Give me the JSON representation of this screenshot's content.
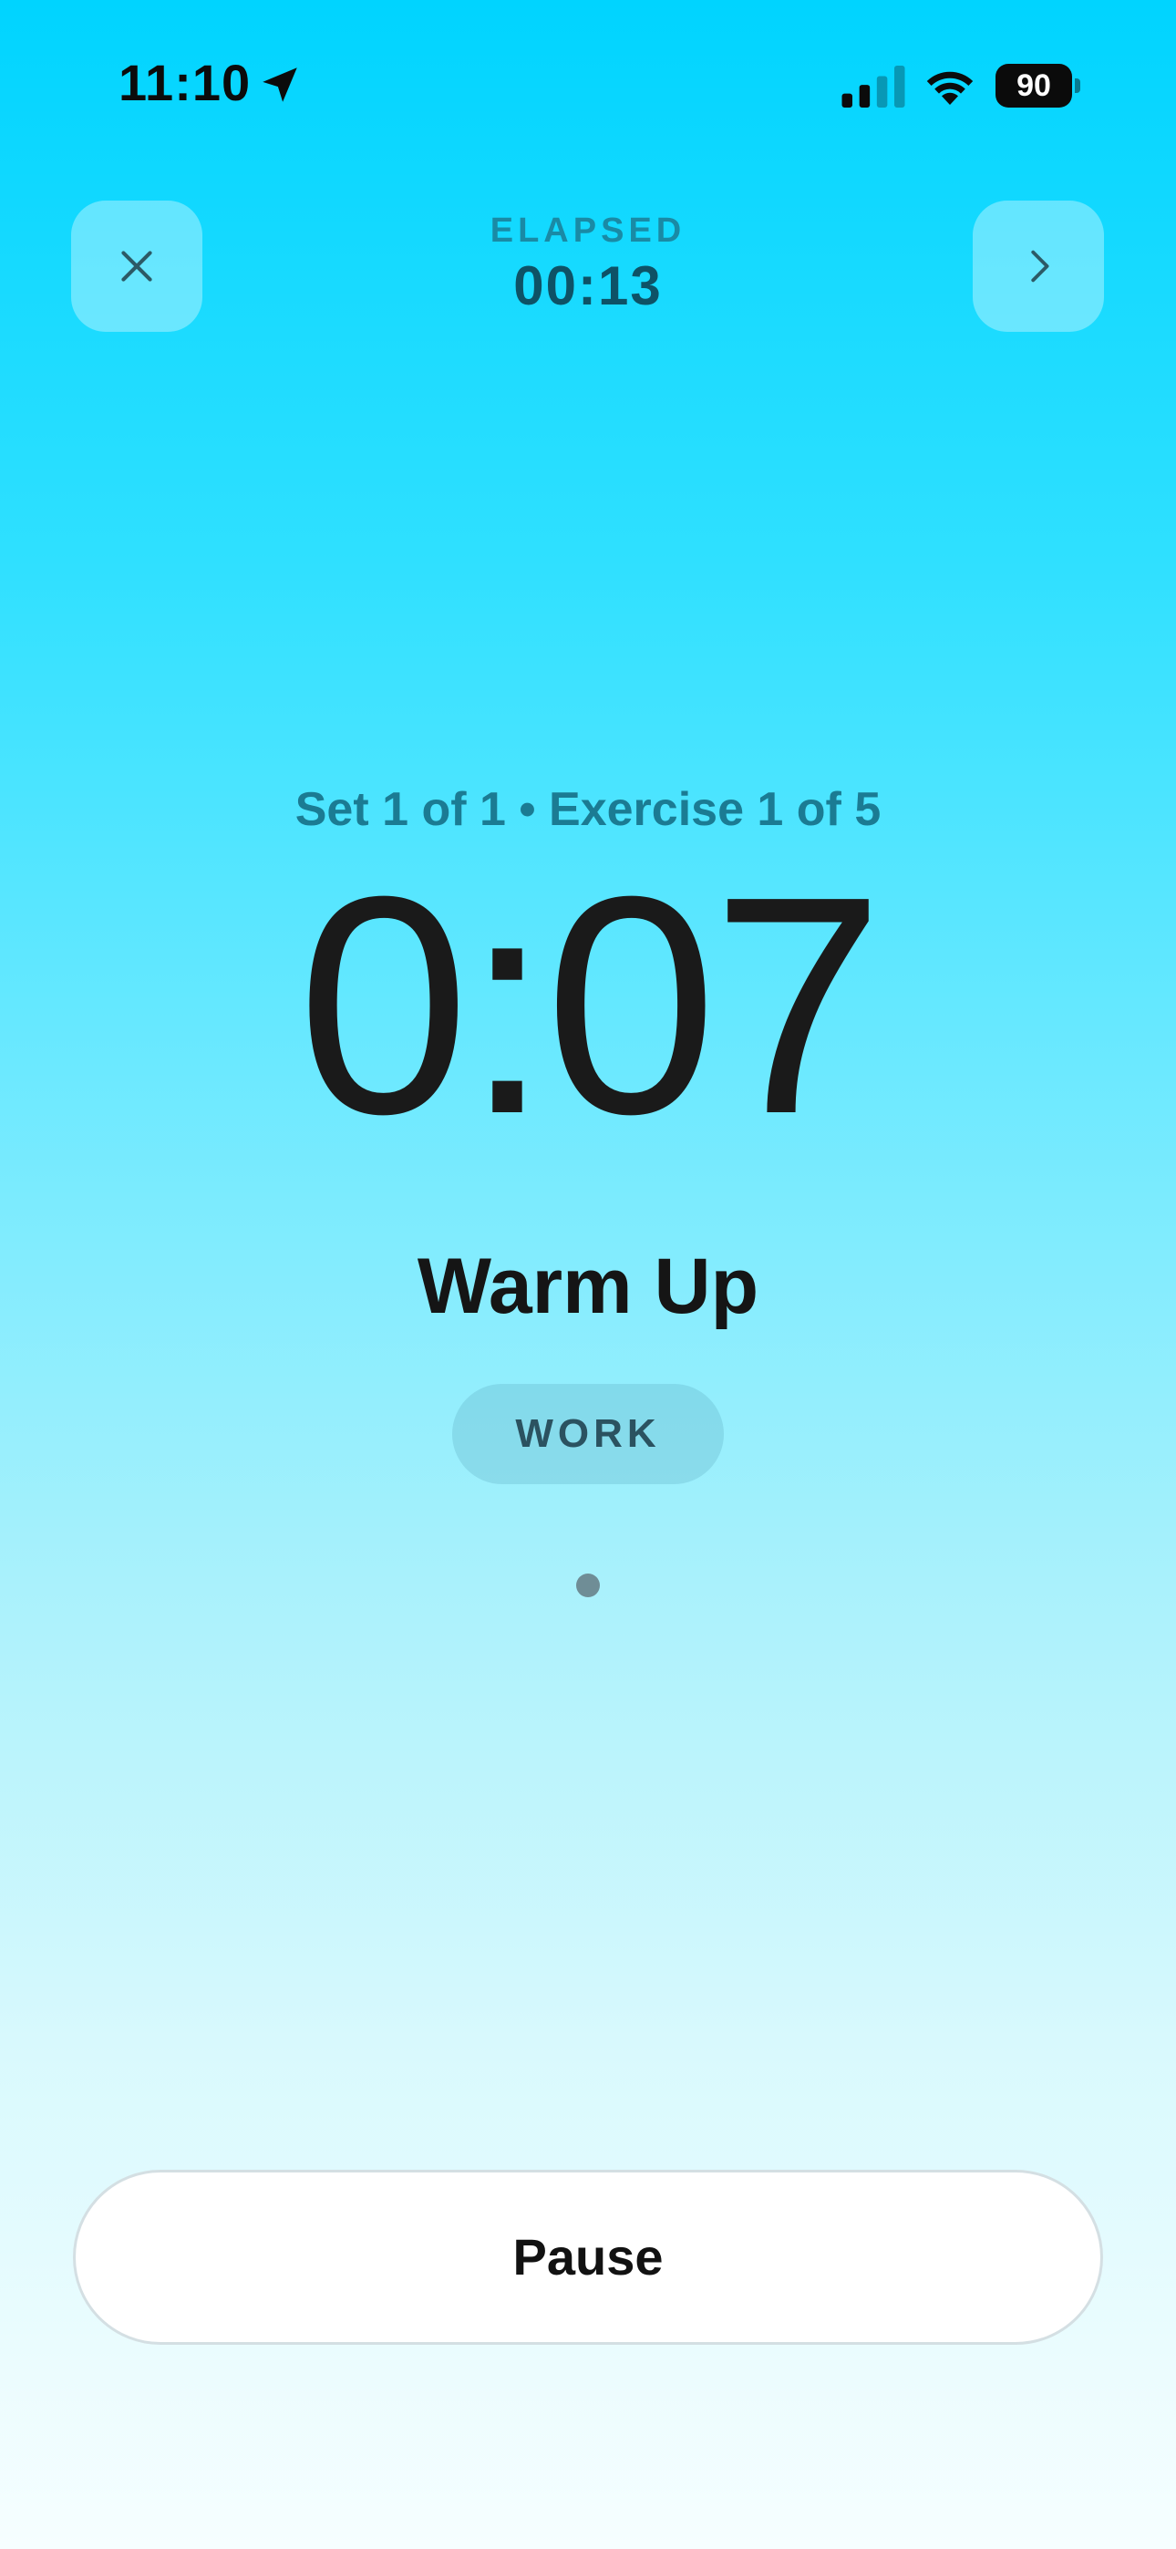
{
  "status_bar": {
    "time": "11:10",
    "battery_percent": "90",
    "icons": [
      "location-arrow-icon",
      "cellular-signal-icon",
      "wifi-icon",
      "battery-icon"
    ]
  },
  "header": {
    "close_icon": "close-icon",
    "next_icon": "chevron-right-icon",
    "elapsed_label": "ELAPSED",
    "elapsed_value": "00:13"
  },
  "workout": {
    "progress_text": "Set 1 of 1 • Exercise 1 of 5",
    "countdown": "0:07",
    "exercise_name": "Warm Up",
    "phase": "WORK",
    "page_indicator_count": 1,
    "page_indicator_active": 0
  },
  "controls": {
    "pause_label": "Pause"
  },
  "colors": {
    "gradient_top": "#00d4ff",
    "gradient_bottom": "#f6feff",
    "elapsed_label": "#1a8aa5",
    "elapsed_value": "#0e5266",
    "progress_text": "#1b7b93",
    "primary_text": "#151515"
  }
}
